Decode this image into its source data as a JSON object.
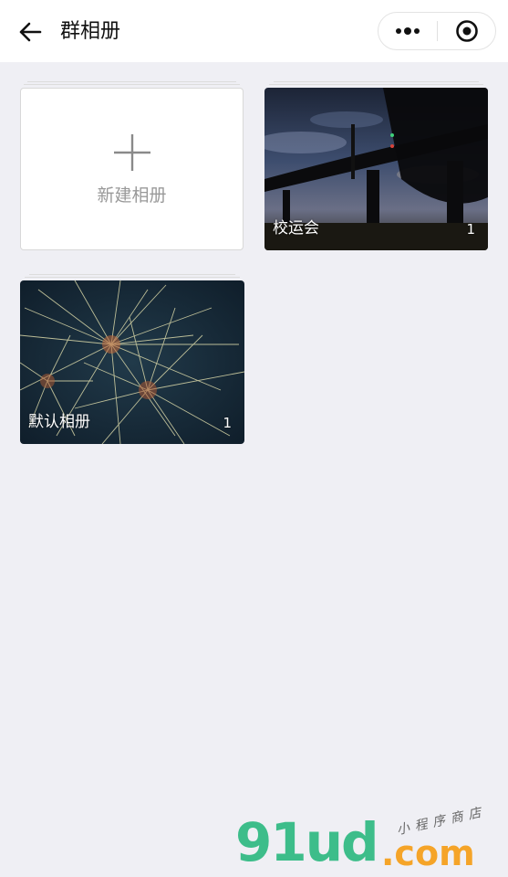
{
  "header": {
    "title": "群相册",
    "back_icon": "arrow-left-icon",
    "more_icon": "more-dots-icon",
    "close_icon": "target-circle-icon"
  },
  "new_album": {
    "label": "新建相册",
    "icon": "plus-icon"
  },
  "albums": [
    {
      "name": "校运会",
      "count": "1",
      "photo": "bridge-night-sky"
    },
    {
      "name": "默认相册",
      "count": "1",
      "photo": "fireworks"
    }
  ],
  "watermark": {
    "logo": "91ud",
    "domain": ".com",
    "tagline": "小程序商店",
    "colors": {
      "logo": "#3dbd8a",
      "domain": "#f5a428"
    }
  },
  "colors": {
    "background": "#efeff4",
    "header_bg": "#ffffff"
  }
}
